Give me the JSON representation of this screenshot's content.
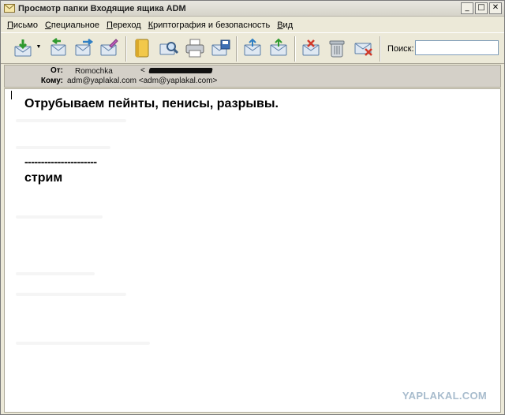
{
  "window": {
    "title": "Просмотр папки Входящие ящика ADM",
    "controls": {
      "minimize": "_",
      "maximize": "□",
      "close": "✕"
    }
  },
  "menubar": {
    "items": [
      {
        "accel": "П",
        "rest": "исьмо"
      },
      {
        "accel": "С",
        "rest": "пециальное"
      },
      {
        "accel": "П",
        "rest": "ереход"
      },
      {
        "accel": "К",
        "rest": "риптография и безопасность"
      },
      {
        "accel": "В",
        "rest": "ид"
      }
    ]
  },
  "toolbar": {
    "buttons": [
      "get-mail-icon",
      "reply-icon",
      "forward-icon",
      "compose-icon",
      "address-book-icon",
      "find-icon",
      "print-icon",
      "save-icon",
      "move-icon",
      "copy-icon",
      "delete-message-icon",
      "trash-icon",
      "block-sender-icon"
    ],
    "search_label": "Поиск:",
    "search_value": ""
  },
  "message": {
    "from_label": "От:",
    "from_name": "Romochka",
    "from_email_open": "<",
    "to_label": "Кому:",
    "to_value": "adm@yaplakal.com <adm@yaplakal.com>",
    "body_line1": "Отрубываем пейнты, пенисы, разрывы.",
    "body_separator": "----------------------",
    "body_line2": "стрим"
  },
  "watermark": "YAPLAKAL.COM",
  "colors": {
    "window_bg": "#ece9d8",
    "content_bg": "#ffffff",
    "watermark": "#a8bccd"
  }
}
